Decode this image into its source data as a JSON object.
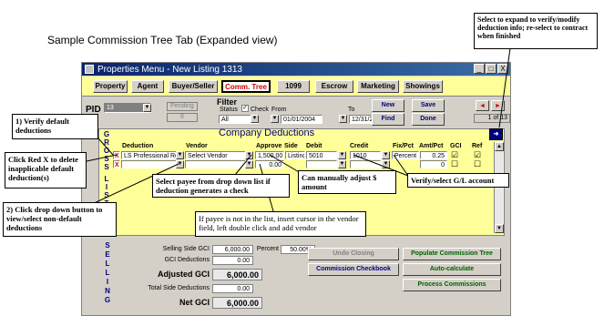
{
  "page_title": "Sample Commission Tree Tab (Expanded view)",
  "window": {
    "title": "Properties Menu - New Listing 1313",
    "controls": [
      "_",
      "□",
      "X"
    ]
  },
  "tabs": [
    {
      "label": "Property",
      "active": false
    },
    {
      "label": "Agent",
      "active": false
    },
    {
      "label": "Buyer/Seller",
      "active": false
    },
    {
      "label": "Comm. Tree",
      "active": true
    },
    {
      "label": "1099",
      "active": false
    },
    {
      "label": "Escrow",
      "active": false
    },
    {
      "label": "Marketing",
      "active": false
    },
    {
      "label": "Showings",
      "active": false
    }
  ],
  "pid": {
    "label": "PID",
    "value": "13",
    "pending_label": "Pending",
    "pending_value": "6"
  },
  "filter": {
    "label": "Filter",
    "status_label": "Status",
    "check_label": "Check",
    "from_label": "From",
    "to_label": "To",
    "status_value": "All",
    "from_date": "01/01/2004",
    "to_date": "12/31/2004"
  },
  "actions": {
    "new": "New",
    "save": "Save",
    "find": "Find",
    "done": "Done"
  },
  "nav": {
    "record_text": "1 of 13"
  },
  "deductions": {
    "title": "Company Deductions",
    "side_letters": [
      "G",
      "R",
      "O",
      "S",
      "S",
      "",
      "L",
      "I",
      "S",
      "T",
      "I",
      "N",
      "G"
    ],
    "columns": [
      "Deduction",
      "Vendor",
      "Approve",
      "Side",
      "Debit",
      "Credit",
      "Fix/Pct",
      "Amt/Pct",
      "GCI",
      "Ref"
    ],
    "rows": [
      {
        "x": "X",
        "deduction": "LS Professional Ref",
        "vendor": "Select Vendor",
        "approve": "1,500.00",
        "side": "Listing",
        "debit": "5010",
        "credit": "1010",
        "fixpct": "Percent",
        "amtpct": "0.25",
        "gci": "☑",
        "ref": "☑"
      },
      {
        "x": "X",
        "deduction": "",
        "vendor": "",
        "approve": "0.00",
        "side": "",
        "debit": "",
        "credit": "",
        "fixpct": "",
        "amtpct": "0",
        "gci": "☐",
        "ref": "☐"
      }
    ]
  },
  "selling": {
    "side_letters": [
      "S",
      "E",
      "L",
      "L",
      "I",
      "N",
      "G"
    ],
    "selling_side_gci_label": "Selling Side GCI",
    "selling_side_gci": "6,000.00",
    "percent_label": "Percent",
    "percent": "50.00%",
    "gci_deductions_label": "GCI Deductions",
    "gci_deductions": "0.00",
    "adjusted_gci_label": "Adjusted GCI",
    "adjusted_gci": "6,000.00",
    "total_side_deductions_label": "Total Side Deductions",
    "total_side_deductions": "0.00",
    "net_gci_label": "Net GCI",
    "net_gci": "6,000.00"
  },
  "buttons": {
    "undo_closing": "Undo Closing",
    "populate": "Populate Commission Tree",
    "checkbook": "Commission Checkbook",
    "autocalc": "Auto-calculate",
    "process": "Process Commissions"
  },
  "callouts": {
    "expand": "Select to expand to verify/modify deduction info; re-select to contract when finished",
    "verify_default": "1) Verify default deductions",
    "red_x": "Click Red X to delete inapplicable default deduction(s)",
    "dropdown": "2) Click drop down button to view/select non-default deductions",
    "payee": "Select payee from drop down list if deduction generates a check",
    "manual": "Can manually adjust $ amount",
    "gl": "Verify/select G/L account",
    "vendor_note": "If payee is not in the list, insert cursor in the vendor field, left double click and add vendor"
  },
  "colors": {
    "tab_bar": "#ffff99",
    "title_bar": "#0a246a",
    "accent_text": "#00007f",
    "active_tab_text": "#cc0000"
  }
}
